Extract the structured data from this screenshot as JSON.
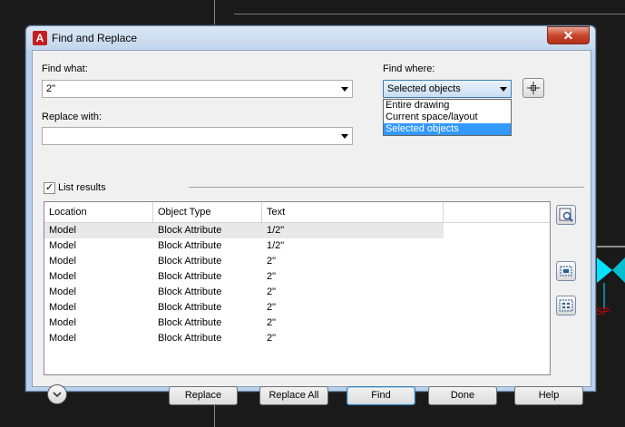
{
  "window": {
    "title": "Find and Replace",
    "close_glyph": "✕"
  },
  "find": {
    "label": "Find what:",
    "value": "2\""
  },
  "replace": {
    "label": "Replace with:",
    "value": ""
  },
  "find_where": {
    "label": "Find where:",
    "selected": "Selected objects",
    "options": [
      "Entire drawing",
      "Current space/layout",
      "Selected objects"
    ]
  },
  "list_results": {
    "label": "List results",
    "checked": true
  },
  "table": {
    "columns": [
      "Location",
      "Object Type",
      "Text"
    ],
    "rows": [
      [
        "Model",
        "Block Attribute",
        "1/2\""
      ],
      [
        "Model",
        "Block Attribute",
        "1/2\""
      ],
      [
        "Model",
        "Block Attribute",
        "2\""
      ],
      [
        "Model",
        "Block Attribute",
        "2\""
      ],
      [
        "Model",
        "Block Attribute",
        "2\""
      ],
      [
        "Model",
        "Block Attribute",
        "2\""
      ],
      [
        "Model",
        "Block Attribute",
        "2\""
      ],
      [
        "Model",
        "Block Attribute",
        "2\""
      ]
    ]
  },
  "buttons": {
    "replace": "Replace",
    "replace_all": "Replace All",
    "find": "Find",
    "done": "Done",
    "help": "Help"
  },
  "background": {
    "side_label": "SP-"
  },
  "colors": {
    "title_bar": "#c2d6ec",
    "selection": "#3399ff",
    "close": "#c8462c",
    "side_fig": "#00e5ff",
    "side_label": "#e00000"
  }
}
